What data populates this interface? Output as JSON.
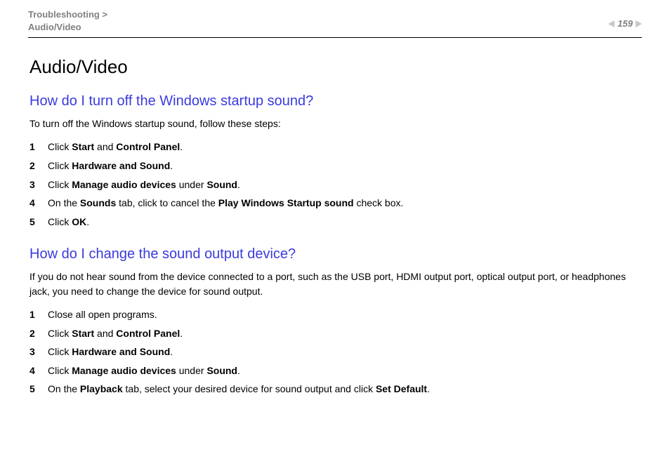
{
  "header": {
    "breadcrumb_line1": "Troubleshooting >",
    "breadcrumb_line2": "Audio/Video",
    "page_number": "159"
  },
  "title": "Audio/Video",
  "section1": {
    "heading": "How do I turn off the Windows startup sound?",
    "intro": "To turn off the Windows startup sound, follow these steps:",
    "steps": [
      {
        "num": "1",
        "html": "Click <b>Start</b> and <b>Control Panel</b>."
      },
      {
        "num": "2",
        "html": "Click <b>Hardware and Sound</b>."
      },
      {
        "num": "3",
        "html": "Click <b>Manage audio devices</b> under <b>Sound</b>."
      },
      {
        "num": "4",
        "html": "On the <b>Sounds</b> tab, click to cancel the <b>Play Windows Startup sound</b> check box."
      },
      {
        "num": "5",
        "html": "Click <b>OK</b>."
      }
    ]
  },
  "section2": {
    "heading": "How do I change the sound output device?",
    "intro": "If you do not hear sound from the device connected to a port, such as the USB port, HDMI output port, optical output port, or headphones jack, you need to change the device for sound output.",
    "steps": [
      {
        "num": "1",
        "html": "Close all open programs."
      },
      {
        "num": "2",
        "html": "Click <b>Start</b> and <b>Control Panel</b>."
      },
      {
        "num": "3",
        "html": "Click <b>Hardware and Sound</b>."
      },
      {
        "num": "4",
        "html": "Click <b>Manage audio devices</b> under <b>Sound</b>."
      },
      {
        "num": "5",
        "html": "On the <b>Playback</b> tab, select your desired device for sound output and click <b>Set Default</b>."
      }
    ]
  }
}
